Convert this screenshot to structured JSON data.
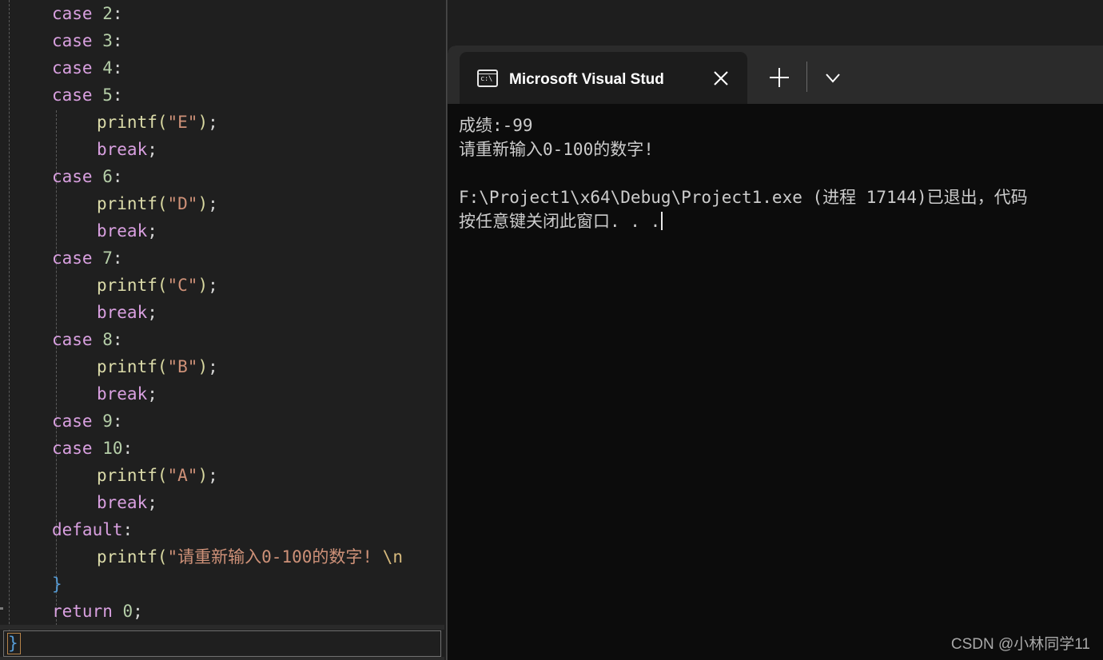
{
  "editor": {
    "theme": {
      "background": "#1f1f1f",
      "keyword": "#d9a0e0",
      "number": "#b5cea8",
      "function": "#dcdcaa",
      "string": "#ce9178",
      "brace": "#569cd6",
      "escape": "#d7ba7d",
      "default_text": "#d4d4d4"
    },
    "lines": [
      {
        "indent": 0,
        "tokens": [
          {
            "t": "case ",
            "c": "kw"
          },
          {
            "t": "2",
            "c": "num"
          },
          {
            "t": ":",
            "c": "punct"
          }
        ]
      },
      {
        "indent": 0,
        "tokens": [
          {
            "t": "case ",
            "c": "kw"
          },
          {
            "t": "3",
            "c": "num"
          },
          {
            "t": ":",
            "c": "punct"
          }
        ]
      },
      {
        "indent": 0,
        "tokens": [
          {
            "t": "case ",
            "c": "kw"
          },
          {
            "t": "4",
            "c": "num"
          },
          {
            "t": ":",
            "c": "punct"
          }
        ]
      },
      {
        "indent": 0,
        "tokens": [
          {
            "t": "case ",
            "c": "kw"
          },
          {
            "t": "5",
            "c": "num"
          },
          {
            "t": ":",
            "c": "punct"
          }
        ]
      },
      {
        "indent": 1,
        "tokens": [
          {
            "t": "printf",
            "c": "fn"
          },
          {
            "t": "(",
            "c": "paren"
          },
          {
            "t": "\"E\"",
            "c": "str"
          },
          {
            "t": ")",
            "c": "paren"
          },
          {
            "t": ";",
            "c": "punct"
          }
        ]
      },
      {
        "indent": 1,
        "tokens": [
          {
            "t": "break",
            "c": "kw"
          },
          {
            "t": ";",
            "c": "punct"
          }
        ]
      },
      {
        "indent": 0,
        "tokens": [
          {
            "t": "case ",
            "c": "kw"
          },
          {
            "t": "6",
            "c": "num"
          },
          {
            "t": ":",
            "c": "punct"
          }
        ]
      },
      {
        "indent": 1,
        "tokens": [
          {
            "t": "printf",
            "c": "fn"
          },
          {
            "t": "(",
            "c": "paren"
          },
          {
            "t": "\"D\"",
            "c": "str"
          },
          {
            "t": ")",
            "c": "paren"
          },
          {
            "t": ";",
            "c": "punct"
          }
        ]
      },
      {
        "indent": 1,
        "tokens": [
          {
            "t": "break",
            "c": "kw"
          },
          {
            "t": ";",
            "c": "punct"
          }
        ]
      },
      {
        "indent": 0,
        "tokens": [
          {
            "t": "case ",
            "c": "kw"
          },
          {
            "t": "7",
            "c": "num"
          },
          {
            "t": ":",
            "c": "punct"
          }
        ]
      },
      {
        "indent": 1,
        "tokens": [
          {
            "t": "printf",
            "c": "fn"
          },
          {
            "t": "(",
            "c": "paren"
          },
          {
            "t": "\"C\"",
            "c": "str"
          },
          {
            "t": ")",
            "c": "paren"
          },
          {
            "t": ";",
            "c": "punct"
          }
        ]
      },
      {
        "indent": 1,
        "tokens": [
          {
            "t": "break",
            "c": "kw"
          },
          {
            "t": ";",
            "c": "punct"
          }
        ]
      },
      {
        "indent": 0,
        "tokens": [
          {
            "t": "case ",
            "c": "kw"
          },
          {
            "t": "8",
            "c": "num"
          },
          {
            "t": ":",
            "c": "punct"
          }
        ]
      },
      {
        "indent": 1,
        "tokens": [
          {
            "t": "printf",
            "c": "fn"
          },
          {
            "t": "(",
            "c": "paren"
          },
          {
            "t": "\"B\"",
            "c": "str"
          },
          {
            "t": ")",
            "c": "paren"
          },
          {
            "t": ";",
            "c": "punct"
          }
        ]
      },
      {
        "indent": 1,
        "tokens": [
          {
            "t": "break",
            "c": "kw"
          },
          {
            "t": ";",
            "c": "punct"
          }
        ]
      },
      {
        "indent": 0,
        "tokens": [
          {
            "t": "case ",
            "c": "kw"
          },
          {
            "t": "9",
            "c": "num"
          },
          {
            "t": ":",
            "c": "punct"
          }
        ]
      },
      {
        "indent": 0,
        "tokens": [
          {
            "t": "case ",
            "c": "kw"
          },
          {
            "t": "10",
            "c": "num"
          },
          {
            "t": ":",
            "c": "punct"
          }
        ]
      },
      {
        "indent": 1,
        "tokens": [
          {
            "t": "printf",
            "c": "fn"
          },
          {
            "t": "(",
            "c": "paren"
          },
          {
            "t": "\"A\"",
            "c": "str"
          },
          {
            "t": ")",
            "c": "paren"
          },
          {
            "t": ";",
            "c": "punct"
          }
        ]
      },
      {
        "indent": 1,
        "tokens": [
          {
            "t": "break",
            "c": "kw"
          },
          {
            "t": ";",
            "c": "punct"
          }
        ]
      },
      {
        "indent": 0,
        "tokens": [
          {
            "t": "default",
            "c": "kw"
          },
          {
            "t": ":",
            "c": "punct"
          }
        ]
      },
      {
        "indent": 1,
        "tokens": [
          {
            "t": "printf",
            "c": "fn"
          },
          {
            "t": "(",
            "c": "paren"
          },
          {
            "t": "\"请重新输入0-100的数字!",
            "c": "str"
          },
          {
            "t": " \\n",
            "c": "esc"
          }
        ]
      },
      {
        "indent": 0,
        "tokens": [
          {
            "t": "}",
            "c": "brace"
          }
        ]
      },
      {
        "indent": 0,
        "tokens": [
          {
            "t": "return ",
            "c": "kw"
          },
          {
            "t": "0",
            "c": "num"
          },
          {
            "t": ";",
            "c": "punct"
          }
        ]
      }
    ],
    "current_line": {
      "text": "}",
      "color_class": "brace"
    }
  },
  "terminal": {
    "tab": {
      "title": "Microsoft Visual Studio 调试控",
      "icon": "console-icon",
      "icon_glyph": "c:\\",
      "close_label": "×"
    },
    "new_tab_label": "+",
    "dropdown_label": "⌄",
    "output": [
      "成绩:-99",
      "请重新输入0-100的数字!",
      "",
      "F:\\Project1\\x64\\Debug\\Project1.exe (进程 17144)已退出，代码",
      "按任意键关闭此窗口. . ."
    ]
  },
  "watermark": {
    "text": "CSDN @小林同学11"
  }
}
